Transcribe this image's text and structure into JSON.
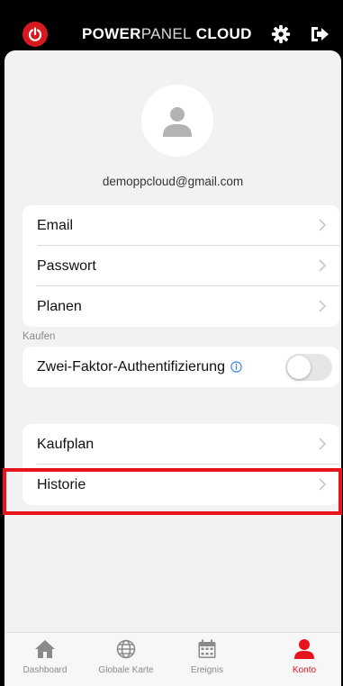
{
  "header": {
    "brand_part1": "POWER",
    "brand_part2": "PANEL",
    "brand_part3": " CLOUD"
  },
  "profile": {
    "email": "demoppcloud@gmail.com"
  },
  "account_items": [
    {
      "label": "Email"
    },
    {
      "label": "Passwort"
    },
    {
      "label": "Planen"
    }
  ],
  "two_factor": {
    "label": "Zwei-Faktor-Authentifizierung",
    "enabled": false
  },
  "purchase": {
    "section_label": "Kaufen",
    "items": [
      {
        "label": "Kaufplan"
      },
      {
        "label": "Historie"
      }
    ]
  },
  "tabs": [
    {
      "label": "Dashboard",
      "icon": "home-icon"
    },
    {
      "label": "Globale Karte",
      "icon": "globe-icon"
    },
    {
      "label": "Ereignis",
      "icon": "calendar-icon"
    },
    {
      "label": "Konto",
      "icon": "user-icon"
    }
  ],
  "colors": {
    "accent": "#e8141b",
    "header_bg": "#000000",
    "page_bg": "#f2f2f2"
  }
}
